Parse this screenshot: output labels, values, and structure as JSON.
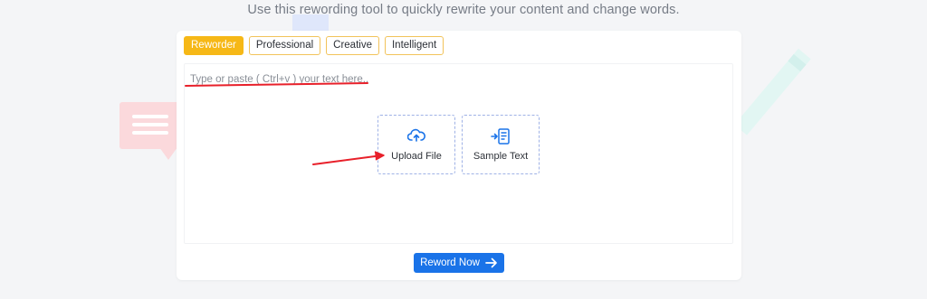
{
  "header": {
    "subtitle": "Use this rewording tool to quickly rewrite your content and change words."
  },
  "tabs": [
    {
      "label": "Reworder",
      "active": true
    },
    {
      "label": "Professional",
      "active": false
    },
    {
      "label": "Creative",
      "active": false
    },
    {
      "label": "Intelligent",
      "active": false
    }
  ],
  "editor": {
    "placeholder": "Type or paste ( Ctrl+v ) your text here..",
    "value": ""
  },
  "actions": {
    "upload": {
      "label": "Upload File",
      "icon": "cloud-upload-icon"
    },
    "sample": {
      "label": "Sample Text",
      "icon": "sample-text-icon"
    }
  },
  "submit": {
    "label": "Reword Now",
    "icon": "arrow-right-icon"
  },
  "colors": {
    "accent": "#1a73e8",
    "active_tab": "#f6b817",
    "tab_border": "#f2c35a",
    "annotation": "#e8202a"
  }
}
